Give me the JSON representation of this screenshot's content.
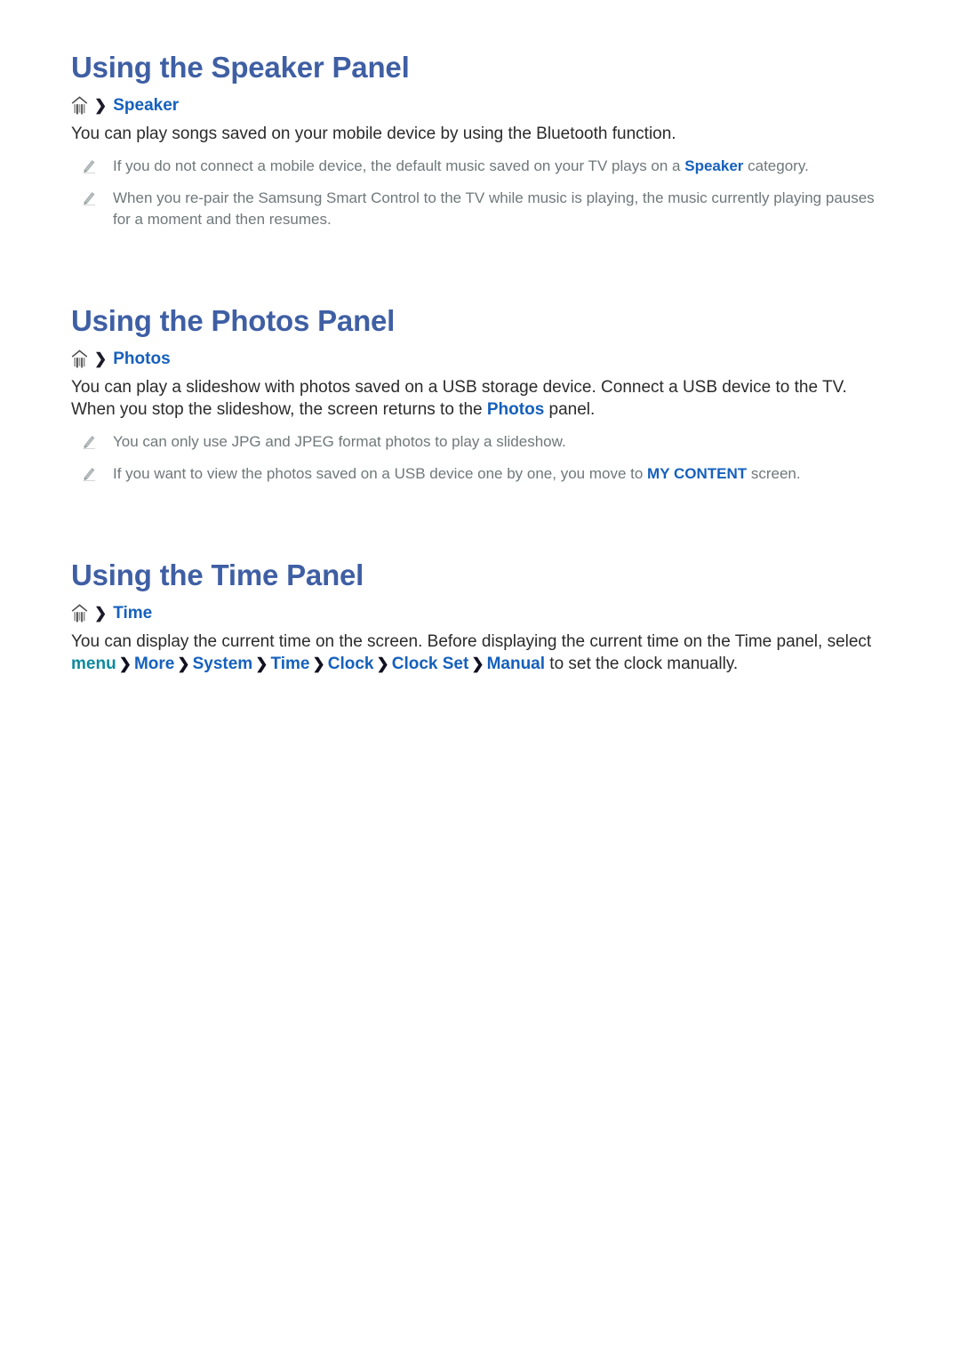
{
  "document": {
    "accent_heading_color": "#3f5fa4",
    "link_color": "#1560bd",
    "menu_keyword_color": "#0d8a9e",
    "note_text_color": "#6f787a",
    "body_text_color": "#2b2b2b"
  },
  "sections": [
    {
      "id": "speaker",
      "title": "Using the Speaker Panel",
      "breadcrumb": {
        "home_icon": "home-panel-icon",
        "separator": "❯",
        "target": "Speaker"
      },
      "paragraphs": [
        "You can play songs saved on your mobile device by using the Bluetooth function."
      ],
      "notes": [
        {
          "icon": "pencil-icon",
          "before": "If you do not connect a mobile device, the default music saved on your TV plays on a ",
          "link": "Speaker",
          "after": " category."
        },
        {
          "icon": "pencil-icon",
          "before": "When you re-pair the Samsung Smart Control to the TV while music is playing, the music currently playing pauses for a moment and then resumes.",
          "link": "",
          "after": ""
        }
      ]
    },
    {
      "id": "photos",
      "title": "Using the Photos Panel",
      "breadcrumb": {
        "home_icon": "home-panel-icon",
        "separator": "❯",
        "target": "Photos"
      },
      "paragraph_parts": {
        "before": "You can play a slideshow with photos saved on a USB storage device. Connect a USB device to the TV. When you stop the slideshow, the screen returns to the ",
        "link": "Photos",
        "after": " panel."
      },
      "notes": [
        {
          "icon": "pencil-icon",
          "before": "You can only use JPG and JPEG format photos to play a slideshow.",
          "link": "",
          "after": ""
        },
        {
          "icon": "pencil-icon",
          "before": "If you want to view the photos saved on a USB device one by one, you move to ",
          "link": "MY CONTENT",
          "after": " screen."
        }
      ]
    },
    {
      "id": "time",
      "title": "Using the Time Panel",
      "breadcrumb": {
        "home_icon": "home-panel-icon",
        "separator": "❯",
        "target": "Time"
      },
      "paragraph_parts": {
        "line1": "You can display the current time on the screen. Before displaying the current time on the Time panel,",
        "select_label": "select ",
        "menu_keyword": "menu",
        "chain": [
          "More",
          "System",
          "Time",
          "Clock",
          "Clock Set",
          "Manual"
        ],
        "chevron": "❯",
        "tail": " to set the clock manually."
      },
      "notes": []
    }
  ]
}
